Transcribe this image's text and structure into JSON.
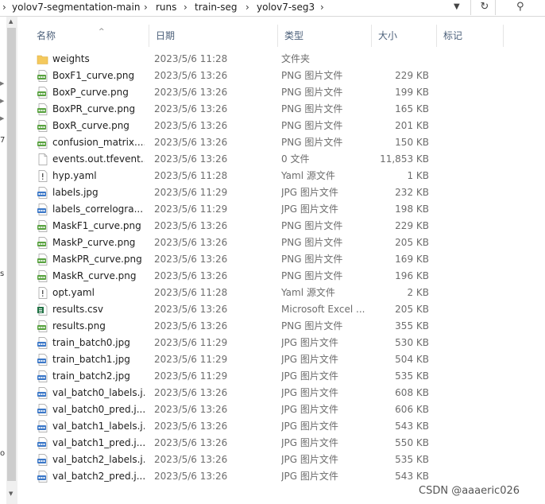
{
  "breadcrumbs": [
    "yolov7-segmentation-main",
    "runs",
    "train-seg",
    "yolov7-seg3"
  ],
  "columns": {
    "name": "名称",
    "date": "日期",
    "type": "类型",
    "size": "大小",
    "tags": "标记"
  },
  "nav_fragments": [
    "7",
    "s",
    "o"
  ],
  "files": [
    {
      "name": "weights",
      "date": "2023/5/6 11:28",
      "type": "文件夹",
      "size": "",
      "icon": "folder-icon"
    },
    {
      "name": "BoxF1_curve.png",
      "date": "2023/5/6 13:26",
      "type": "PNG 图片文件",
      "size": "229 KB",
      "icon": "png-file-icon"
    },
    {
      "name": "BoxP_curve.png",
      "date": "2023/5/6 13:26",
      "type": "PNG 图片文件",
      "size": "199 KB",
      "icon": "png-file-icon"
    },
    {
      "name": "BoxPR_curve.png",
      "date": "2023/5/6 13:26",
      "type": "PNG 图片文件",
      "size": "165 KB",
      "icon": "png-file-icon"
    },
    {
      "name": "BoxR_curve.png",
      "date": "2023/5/6 13:26",
      "type": "PNG 图片文件",
      "size": "201 KB",
      "icon": "png-file-icon"
    },
    {
      "name": "confusion_matrix....",
      "date": "2023/5/6 13:26",
      "type": "PNG 图片文件",
      "size": "150 KB",
      "icon": "png-file-icon"
    },
    {
      "name": "events.out.tfevent...",
      "date": "2023/5/6 13:26",
      "type": "0 文件",
      "size": "11,853 KB",
      "icon": "blank-file-icon"
    },
    {
      "name": "hyp.yaml",
      "date": "2023/5/6 11:28",
      "type": "Yaml 源文件",
      "size": "1 KB",
      "icon": "yaml-file-icon"
    },
    {
      "name": "labels.jpg",
      "date": "2023/5/6 11:29",
      "type": "JPG 图片文件",
      "size": "232 KB",
      "icon": "jpg-file-icon"
    },
    {
      "name": "labels_correlogra...",
      "date": "2023/5/6 11:29",
      "type": "JPG 图片文件",
      "size": "198 KB",
      "icon": "jpg-file-icon"
    },
    {
      "name": "MaskF1_curve.png",
      "date": "2023/5/6 13:26",
      "type": "PNG 图片文件",
      "size": "229 KB",
      "icon": "png-file-icon"
    },
    {
      "name": "MaskP_curve.png",
      "date": "2023/5/6 13:26",
      "type": "PNG 图片文件",
      "size": "205 KB",
      "icon": "png-file-icon"
    },
    {
      "name": "MaskPR_curve.png",
      "date": "2023/5/6 13:26",
      "type": "PNG 图片文件",
      "size": "169 KB",
      "icon": "png-file-icon"
    },
    {
      "name": "MaskR_curve.png",
      "date": "2023/5/6 13:26",
      "type": "PNG 图片文件",
      "size": "196 KB",
      "icon": "png-file-icon"
    },
    {
      "name": "opt.yaml",
      "date": "2023/5/6 11:28",
      "type": "Yaml 源文件",
      "size": "2 KB",
      "icon": "yaml-file-icon"
    },
    {
      "name": "results.csv",
      "date": "2023/5/6 13:26",
      "type": "Microsoft Excel ...",
      "size": "205 KB",
      "icon": "csv-file-icon"
    },
    {
      "name": "results.png",
      "date": "2023/5/6 13:26",
      "type": "PNG 图片文件",
      "size": "355 KB",
      "icon": "png-file-icon"
    },
    {
      "name": "train_batch0.jpg",
      "date": "2023/5/6 11:29",
      "type": "JPG 图片文件",
      "size": "530 KB",
      "icon": "jpg-file-icon"
    },
    {
      "name": "train_batch1.jpg",
      "date": "2023/5/6 11:29",
      "type": "JPG 图片文件",
      "size": "504 KB",
      "icon": "jpg-file-icon"
    },
    {
      "name": "train_batch2.jpg",
      "date": "2023/5/6 11:29",
      "type": "JPG 图片文件",
      "size": "535 KB",
      "icon": "jpg-file-icon"
    },
    {
      "name": "val_batch0_labels.j...",
      "date": "2023/5/6 13:26",
      "type": "JPG 图片文件",
      "size": "608 KB",
      "icon": "jpg-file-icon"
    },
    {
      "name": "val_batch0_pred.j...",
      "date": "2023/5/6 13:26",
      "type": "JPG 图片文件",
      "size": "606 KB",
      "icon": "jpg-file-icon"
    },
    {
      "name": "val_batch1_labels.j...",
      "date": "2023/5/6 13:26",
      "type": "JPG 图片文件",
      "size": "543 KB",
      "icon": "jpg-file-icon"
    },
    {
      "name": "val_batch1_pred.j...",
      "date": "2023/5/6 13:26",
      "type": "JPG 图片文件",
      "size": "550 KB",
      "icon": "jpg-file-icon"
    },
    {
      "name": "val_batch2_labels.j...",
      "date": "2023/5/6 13:26",
      "type": "JPG 图片文件",
      "size": "535 KB",
      "icon": "jpg-file-icon"
    },
    {
      "name": "val_batch2_pred.j...",
      "date": "2023/5/6 13:26",
      "type": "JPG 图片文件",
      "size": "543 KB",
      "icon": "jpg-file-icon"
    }
  ],
  "watermark": "CSDN @aaaeric026",
  "colors": {
    "png_green": "#5aa341",
    "jpg_blue": "#3c78c8",
    "folder_yellow": "#f4c95d",
    "header_text": "#4c607a"
  }
}
